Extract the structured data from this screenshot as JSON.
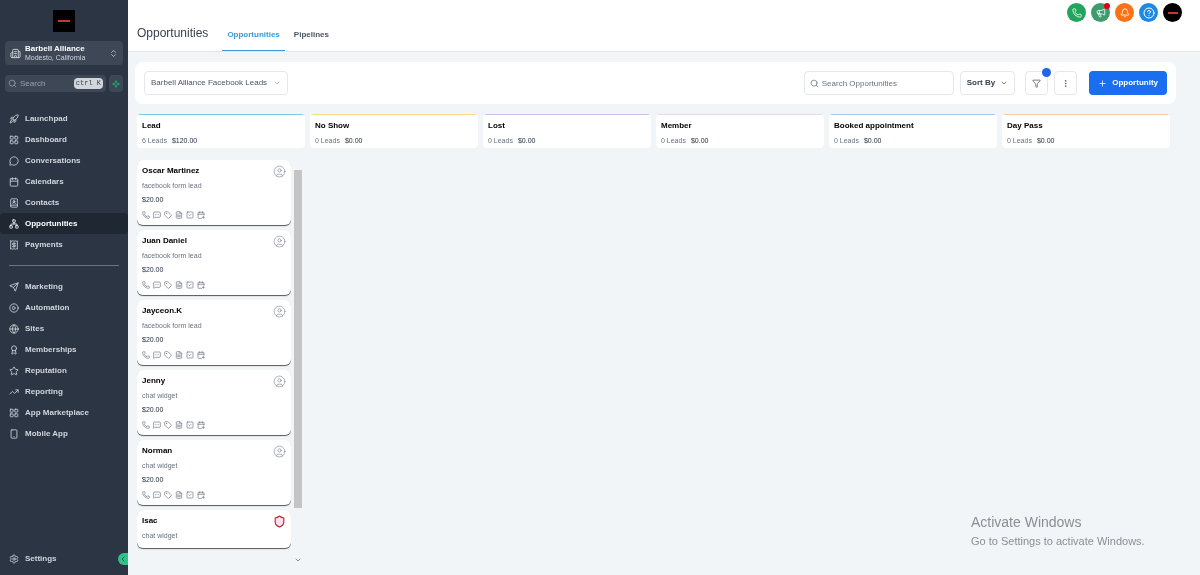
{
  "sidebar": {
    "account": {
      "name": "Barbell Alliance",
      "location": "Modesto, California"
    },
    "search": {
      "placeholder": "Search",
      "shortcut": "ctrl K"
    },
    "items": [
      {
        "label": "Launchpad",
        "selected": false
      },
      {
        "label": "Dashboard",
        "selected": false
      },
      {
        "label": "Conversations",
        "selected": false
      },
      {
        "label": "Calendars",
        "selected": false
      },
      {
        "label": "Contacts",
        "selected": false
      },
      {
        "label": "Opportunities",
        "selected": true
      },
      {
        "label": "Payments",
        "selected": false
      },
      {
        "kind": "divider"
      },
      {
        "label": "Marketing",
        "selected": false
      },
      {
        "label": "Automation",
        "selected": false
      },
      {
        "label": "Sites",
        "selected": false
      },
      {
        "label": "Memberships",
        "selected": false
      },
      {
        "label": "Reputation",
        "selected": false
      },
      {
        "label": "Reporting",
        "selected": false
      },
      {
        "label": "App Marketplace",
        "selected": false
      },
      {
        "label": "Mobile App",
        "selected": false
      }
    ],
    "settings": "Settings"
  },
  "header": {
    "title": "Opportunities",
    "tabs": [
      {
        "label": "Opportunities",
        "selected": true
      },
      {
        "label": "Pipelines",
        "selected": false
      }
    ],
    "notification_dot": true
  },
  "toolbar": {
    "pipeline": "Barbell Alliance Facebook Leads",
    "search": {
      "placeholder": "Search Opportunities"
    },
    "sort": "Sort By",
    "filter_active": true,
    "add_button": "Opportunity"
  },
  "stages": [
    {
      "name": "Lead",
      "count": "6 Leads",
      "value": "$120.00",
      "color": "#7cc4ec"
    },
    {
      "name": "No Show",
      "count": "0 Leads",
      "value": "$0.00",
      "color": "#f5dd8c"
    },
    {
      "name": "Lost",
      "count": "0 Leads",
      "value": "$0.00",
      "color": "#c9c4ec"
    },
    {
      "name": "Member",
      "count": "0 Leads",
      "value": "$0.00",
      "color": "#dcdce4"
    },
    {
      "name": "Booked appointment",
      "count": "0 Leads",
      "value": "$0.00",
      "color": "#a9c6f0"
    },
    {
      "name": "Day Pass",
      "count": "0 Leads",
      "value": "$0.00",
      "color": "#f3c8a4"
    }
  ],
  "cards": [
    {
      "kind": "person",
      "name": "Oscar Martinez",
      "source": "facebook form lead",
      "amount": "$20.00"
    },
    {
      "kind": "person",
      "name": "Juan Daniel",
      "source": "facebook form lead",
      "amount": "$20.00"
    },
    {
      "kind": "person",
      "name": "Jayceon.K",
      "source": "facebook form lead",
      "amount": "$20.00"
    },
    {
      "kind": "person",
      "name": "Jenny",
      "source": "chat widget",
      "amount": "$20.00"
    },
    {
      "kind": "person",
      "name": "Norman",
      "source": "chat widget",
      "amount": "$20.00"
    },
    {
      "kind": "logo",
      "name": "Isac",
      "source": "chat widget"
    }
  ],
  "os_notice": {
    "title": "Activate Windows",
    "text": "Go to Settings to activate Windows."
  }
}
